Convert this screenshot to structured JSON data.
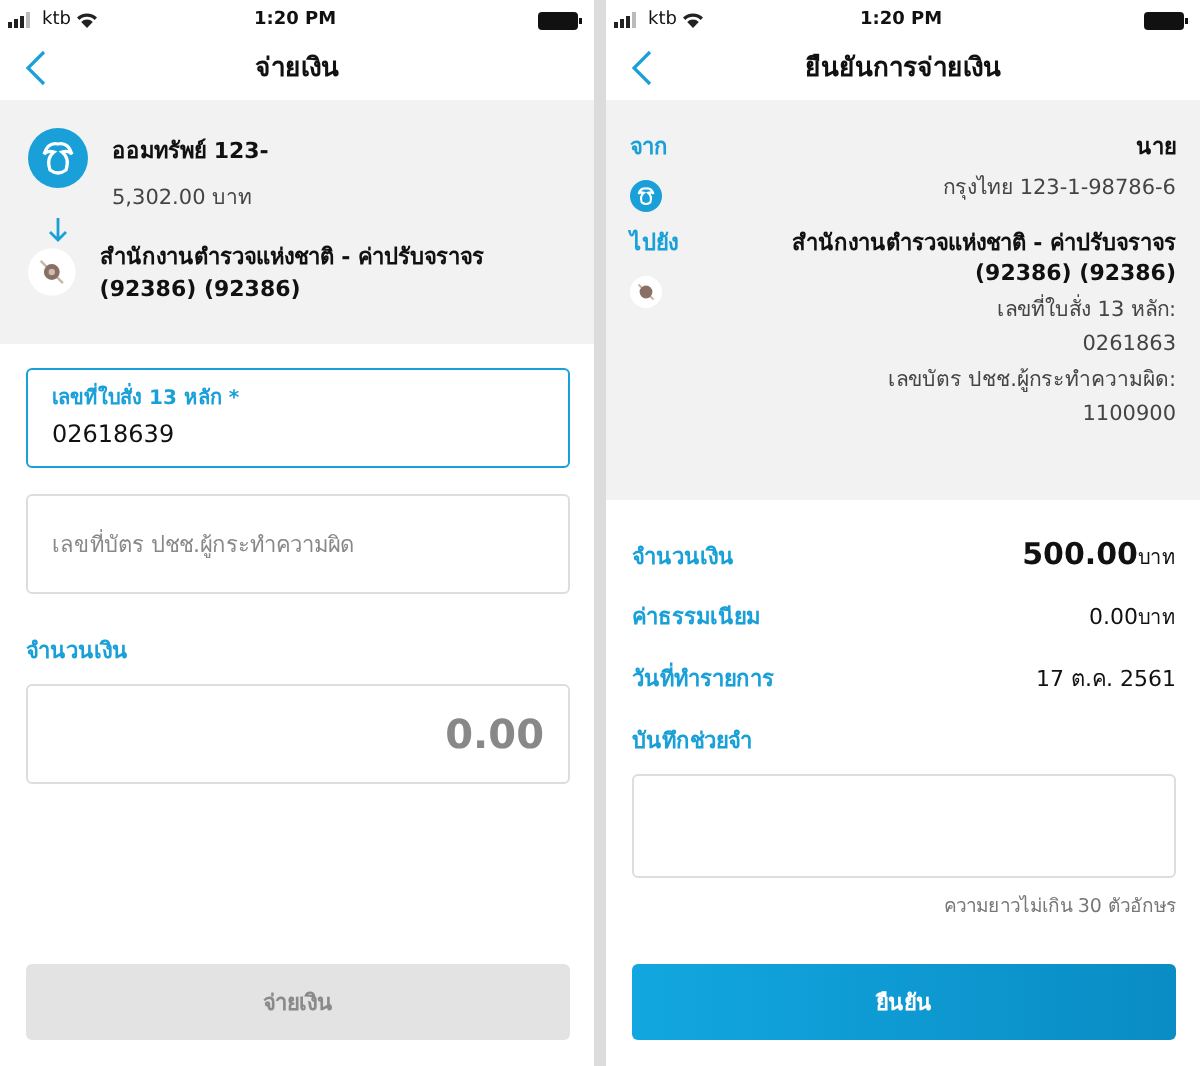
{
  "payment_screen": {
    "status_bar": {
      "carrier": "ktb",
      "time": "1:20 PM"
    },
    "title": "จ่ายเงิน",
    "from": {
      "account": "ออมทรัพย์ 123-",
      "balance": "5,302.00 บาท"
    },
    "to": {
      "payee": "สำนักงานตำรวจแห่งชาติ - ค่าปรับจราจร (92386)  (92386)"
    },
    "fields": [
      {
        "label": "เลขที่ใบสั่ง 13 หลัก *",
        "value": "02618639",
        "focused": true
      },
      {
        "placeholder": "เลขที่บัตร ปชช.ผู้กระทำความผิด",
        "focused": false
      }
    ],
    "amount_label": "จำนวนเงิน",
    "amount_value": "0.00",
    "pay_button": {
      "label": "จ่ายเงิน",
      "disabled": true
    }
  },
  "confirm_screen": {
    "status_bar": {
      "carrier": "ktb",
      "time": "1:20 PM"
    },
    "title": "ยืนยันการจ่ายเงิน",
    "from_label": "จาก",
    "from_name": "นาย",
    "from_account": "กรุงไทย 123-1-98786-6",
    "to_label": "ไปยัง",
    "to_payee": "สำนักงานตำรวจแห่งชาติ - ค่าปรับจราจร (92386)  (92386)",
    "details": [
      {
        "text": "เลขที่ใบสั่ง 13 หลัก:"
      },
      {
        "text": "0261863"
      },
      {
        "text": "เลขบัตร ปชช.ผู้กระทำความผิด:"
      },
      {
        "text": "1100900"
      }
    ],
    "summary": [
      {
        "label": "จำนวนเงิน",
        "value": "500.00",
        "unit": "บาท",
        "emphasis": true
      },
      {
        "label": "ค่าธรรมเนียม",
        "value": "0.00",
        "unit": "บาท",
        "emphasis": false
      },
      {
        "label": "วันที่ทำรายการ",
        "value": "17 ต.ค. 2561",
        "emphasis": false
      }
    ],
    "memo_label": "บันทึกช่วยจำ",
    "memo_hint": "ความยาวไม่เกิน 30 ตัวอักษร",
    "confirm_button": {
      "label": "ยืนยัน",
      "disabled": false
    }
  }
}
